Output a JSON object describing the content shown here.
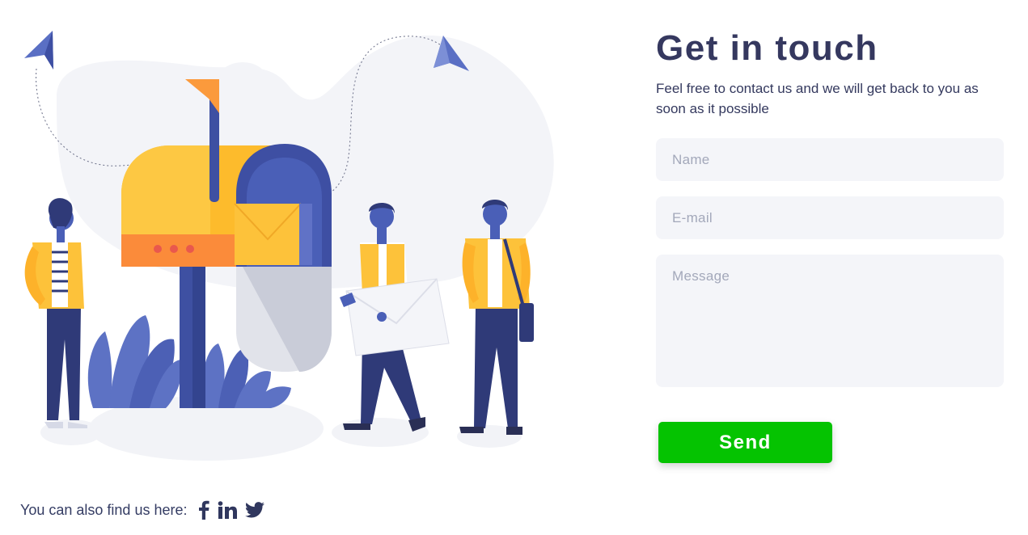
{
  "contact": {
    "title": "Get in touch",
    "subtitle": "Feel free to contact us and we will get back to you as soon as it possible",
    "fields": {
      "name_placeholder": "Name",
      "email_placeholder": "E-mail",
      "message_placeholder": "Message"
    },
    "send_label": "Send"
  },
  "social": {
    "label": "You can also find us here:",
    "icons": [
      "facebook-icon",
      "linkedin-icon",
      "twitter-icon"
    ]
  },
  "colors": {
    "accent_button": "#05c301",
    "heading": "#35385f",
    "field_bg": "#f4f5f9",
    "placeholder": "#a3a8ba",
    "illustration_blue": "#4353a6",
    "illustration_yellow": "#fdbf2d",
    "illustration_orange": "#fb8b3a"
  }
}
